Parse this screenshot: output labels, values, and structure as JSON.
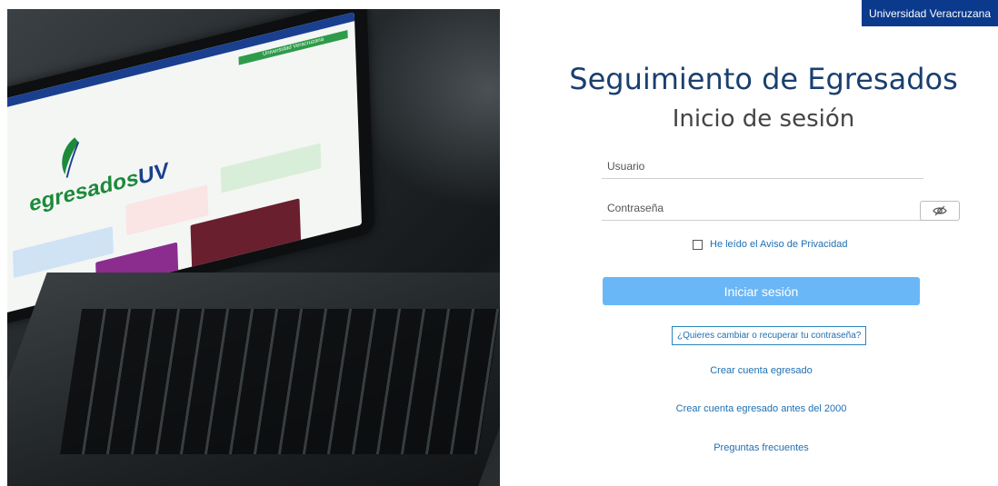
{
  "header": {
    "institution": "Universidad Veracruzana"
  },
  "hero": {
    "screen_brand_green": "egresados",
    "screen_brand_blue": "UV",
    "screen_bar_text": "Universidad Veracruzana"
  },
  "login": {
    "title": "Seguimiento de Egresados",
    "subtitle": "Inicio de sesión",
    "username_placeholder": "Usuario",
    "password_placeholder": "Contraseña",
    "privacy_label": "He leído el Aviso de Privacidad",
    "submit_label": "Iniciar sesión",
    "recover_label": "¿Quieres cambiar o recuperar tu contraseña?",
    "links": {
      "create_account": "Crear cuenta egresado",
      "create_account_pre2000": "Crear cuenta egresado antes del 2000",
      "faq": "Preguntas frecuentes"
    }
  },
  "colors": {
    "primary_blue": "#0b3a8c",
    "button_blue": "#6ab7f7",
    "link_blue": "#1f6fb2",
    "title_color": "#1a3f6f"
  },
  "icons": {
    "password_toggle": "eye-slash-icon"
  }
}
